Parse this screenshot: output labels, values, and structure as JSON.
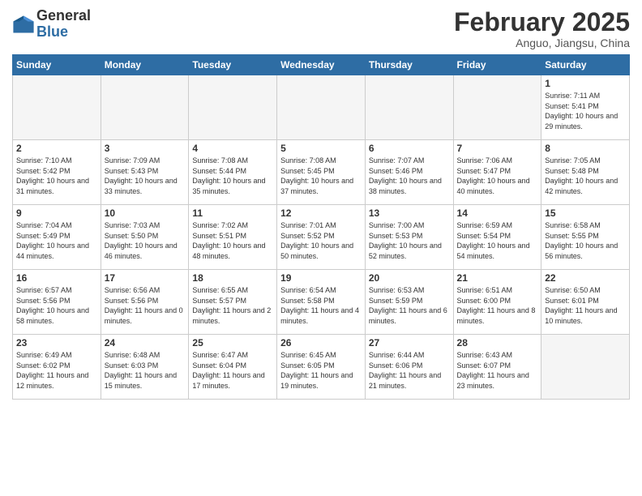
{
  "logo": {
    "general": "General",
    "blue": "Blue"
  },
  "title": "February 2025",
  "location": "Anguo, Jiangsu, China",
  "days_of_week": [
    "Sunday",
    "Monday",
    "Tuesday",
    "Wednesday",
    "Thursday",
    "Friday",
    "Saturday"
  ],
  "weeks": [
    [
      {
        "num": "",
        "info": ""
      },
      {
        "num": "",
        "info": ""
      },
      {
        "num": "",
        "info": ""
      },
      {
        "num": "",
        "info": ""
      },
      {
        "num": "",
        "info": ""
      },
      {
        "num": "",
        "info": ""
      },
      {
        "num": "1",
        "info": "Sunrise: 7:11 AM\nSunset: 5:41 PM\nDaylight: 10 hours and 29 minutes."
      }
    ],
    [
      {
        "num": "2",
        "info": "Sunrise: 7:10 AM\nSunset: 5:42 PM\nDaylight: 10 hours and 31 minutes."
      },
      {
        "num": "3",
        "info": "Sunrise: 7:09 AM\nSunset: 5:43 PM\nDaylight: 10 hours and 33 minutes."
      },
      {
        "num": "4",
        "info": "Sunrise: 7:08 AM\nSunset: 5:44 PM\nDaylight: 10 hours and 35 minutes."
      },
      {
        "num": "5",
        "info": "Sunrise: 7:08 AM\nSunset: 5:45 PM\nDaylight: 10 hours and 37 minutes."
      },
      {
        "num": "6",
        "info": "Sunrise: 7:07 AM\nSunset: 5:46 PM\nDaylight: 10 hours and 38 minutes."
      },
      {
        "num": "7",
        "info": "Sunrise: 7:06 AM\nSunset: 5:47 PM\nDaylight: 10 hours and 40 minutes."
      },
      {
        "num": "8",
        "info": "Sunrise: 7:05 AM\nSunset: 5:48 PM\nDaylight: 10 hours and 42 minutes."
      }
    ],
    [
      {
        "num": "9",
        "info": "Sunrise: 7:04 AM\nSunset: 5:49 PM\nDaylight: 10 hours and 44 minutes."
      },
      {
        "num": "10",
        "info": "Sunrise: 7:03 AM\nSunset: 5:50 PM\nDaylight: 10 hours and 46 minutes."
      },
      {
        "num": "11",
        "info": "Sunrise: 7:02 AM\nSunset: 5:51 PM\nDaylight: 10 hours and 48 minutes."
      },
      {
        "num": "12",
        "info": "Sunrise: 7:01 AM\nSunset: 5:52 PM\nDaylight: 10 hours and 50 minutes."
      },
      {
        "num": "13",
        "info": "Sunrise: 7:00 AM\nSunset: 5:53 PM\nDaylight: 10 hours and 52 minutes."
      },
      {
        "num": "14",
        "info": "Sunrise: 6:59 AM\nSunset: 5:54 PM\nDaylight: 10 hours and 54 minutes."
      },
      {
        "num": "15",
        "info": "Sunrise: 6:58 AM\nSunset: 5:55 PM\nDaylight: 10 hours and 56 minutes."
      }
    ],
    [
      {
        "num": "16",
        "info": "Sunrise: 6:57 AM\nSunset: 5:56 PM\nDaylight: 10 hours and 58 minutes."
      },
      {
        "num": "17",
        "info": "Sunrise: 6:56 AM\nSunset: 5:56 PM\nDaylight: 11 hours and 0 minutes."
      },
      {
        "num": "18",
        "info": "Sunrise: 6:55 AM\nSunset: 5:57 PM\nDaylight: 11 hours and 2 minutes."
      },
      {
        "num": "19",
        "info": "Sunrise: 6:54 AM\nSunset: 5:58 PM\nDaylight: 11 hours and 4 minutes."
      },
      {
        "num": "20",
        "info": "Sunrise: 6:53 AM\nSunset: 5:59 PM\nDaylight: 11 hours and 6 minutes."
      },
      {
        "num": "21",
        "info": "Sunrise: 6:51 AM\nSunset: 6:00 PM\nDaylight: 11 hours and 8 minutes."
      },
      {
        "num": "22",
        "info": "Sunrise: 6:50 AM\nSunset: 6:01 PM\nDaylight: 11 hours and 10 minutes."
      }
    ],
    [
      {
        "num": "23",
        "info": "Sunrise: 6:49 AM\nSunset: 6:02 PM\nDaylight: 11 hours and 12 minutes."
      },
      {
        "num": "24",
        "info": "Sunrise: 6:48 AM\nSunset: 6:03 PM\nDaylight: 11 hours and 15 minutes."
      },
      {
        "num": "25",
        "info": "Sunrise: 6:47 AM\nSunset: 6:04 PM\nDaylight: 11 hours and 17 minutes."
      },
      {
        "num": "26",
        "info": "Sunrise: 6:45 AM\nSunset: 6:05 PM\nDaylight: 11 hours and 19 minutes."
      },
      {
        "num": "27",
        "info": "Sunrise: 6:44 AM\nSunset: 6:06 PM\nDaylight: 11 hours and 21 minutes."
      },
      {
        "num": "28",
        "info": "Sunrise: 6:43 AM\nSunset: 6:07 PM\nDaylight: 11 hours and 23 minutes."
      },
      {
        "num": "",
        "info": ""
      }
    ]
  ]
}
